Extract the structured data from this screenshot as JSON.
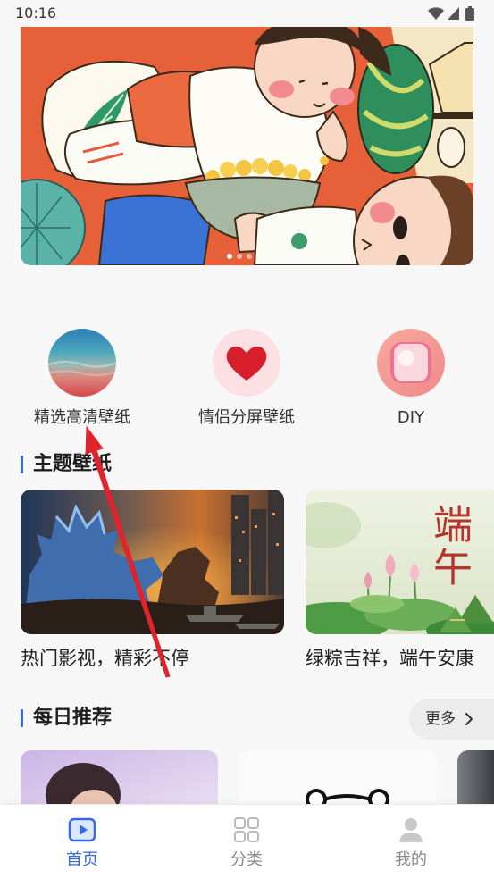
{
  "status_bar": {
    "time": "10:16",
    "icons": [
      "wifi-icon",
      "signal-icon",
      "battery-icon"
    ]
  },
  "categories": [
    {
      "label": "精选高清壁纸",
      "icon": "ocean-wallpaper-icon"
    },
    {
      "label": "情侣分屏壁纸",
      "icon": "heart-icon"
    },
    {
      "label": "DIY",
      "icon": "diy-frame-icon"
    }
  ],
  "theme_section": {
    "title": "主题壁纸",
    "cards": [
      {
        "caption": "热门影视，精彩不停"
      },
      {
        "caption": "绿粽吉祥，端午安康",
        "image_text": "端午"
      }
    ]
  },
  "daily_section": {
    "title": "每日推荐",
    "more_label": "更多",
    "more_icon": "chevron-right-icon"
  },
  "bottom_nav": [
    {
      "label": "首页",
      "icon": "play-icon",
      "active": true
    },
    {
      "label": "分类",
      "icon": "grid-icon",
      "active": false
    },
    {
      "label": "我的",
      "icon": "person-icon",
      "active": false
    }
  ],
  "colors": {
    "accent": "#3468ee",
    "page_background": "#f7f7f7",
    "nav_inactive": "#8a8a8a",
    "annotation_arrow": "#e1232b"
  }
}
